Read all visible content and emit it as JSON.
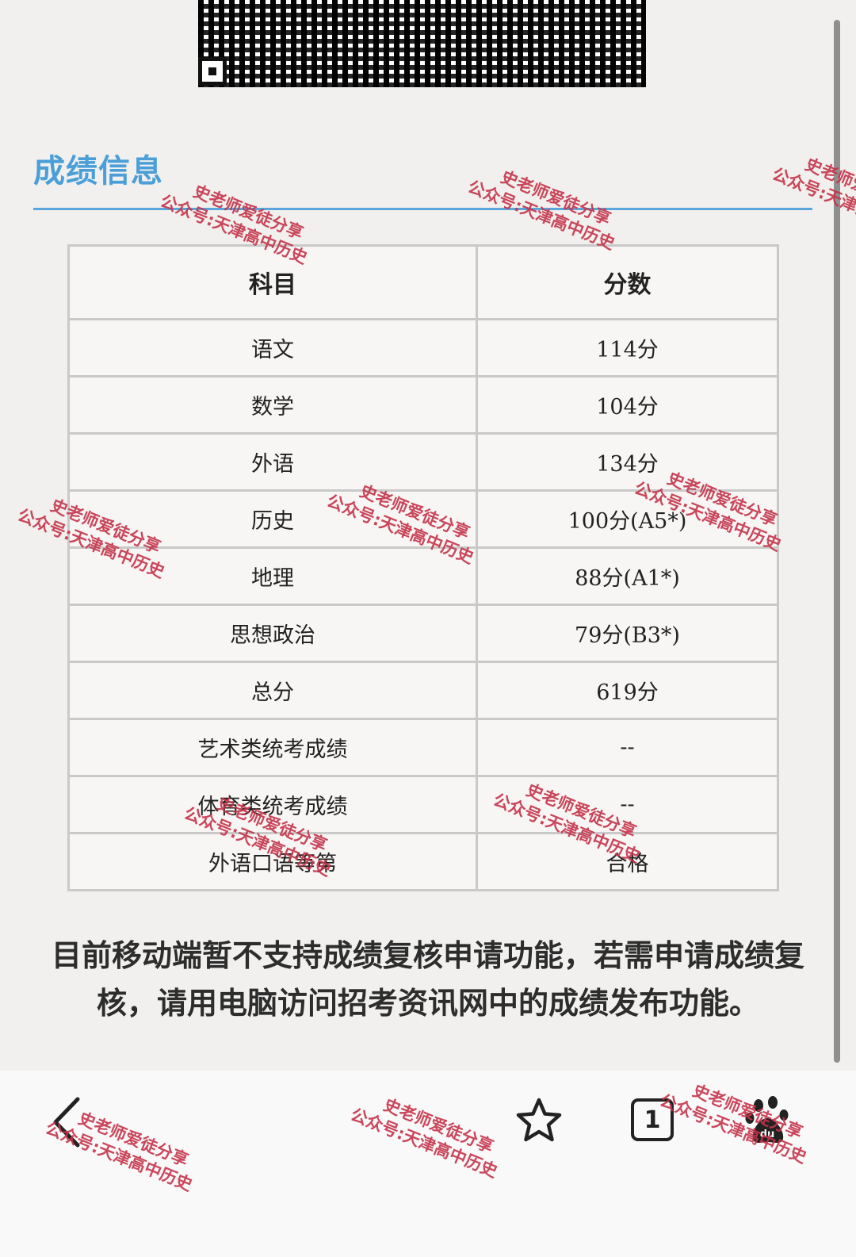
{
  "section_title": "成绩信息",
  "table": {
    "headers": [
      "科目",
      "分数"
    ],
    "rows": [
      {
        "subject": "语文",
        "score": "114分"
      },
      {
        "subject": "数学",
        "score": "104分"
      },
      {
        "subject": "外语",
        "score": "134分"
      },
      {
        "subject": "历史",
        "score": "100分(A5*)"
      },
      {
        "subject": "地理",
        "score": "88分(A1*)"
      },
      {
        "subject": "思想政治",
        "score": "79分(B3*)"
      },
      {
        "subject": "总分",
        "score": "619分"
      },
      {
        "subject": "艺术类统考成绩",
        "score": "--"
      },
      {
        "subject": "体育类统考成绩",
        "score": "--"
      },
      {
        "subject": "外语口语等第",
        "score": "合格"
      }
    ]
  },
  "notice": "目前移动端暂不支持成绩复核申请功能，若需申请成绩复核，请用电脑访问招考资讯网中的成绩发布功能。",
  "toolbar": {
    "back_icon": "chevron-left-icon",
    "star_icon": "star-icon",
    "tab_count": "1",
    "baidu_icon": "baidu-paw-icon"
  },
  "watermark": {
    "line1": "史老师爱徒分享",
    "line2": "公众号:天津高中历史"
  },
  "colors": {
    "title_blue": "#4a9fd8",
    "watermark_red": "#c5344a"
  }
}
